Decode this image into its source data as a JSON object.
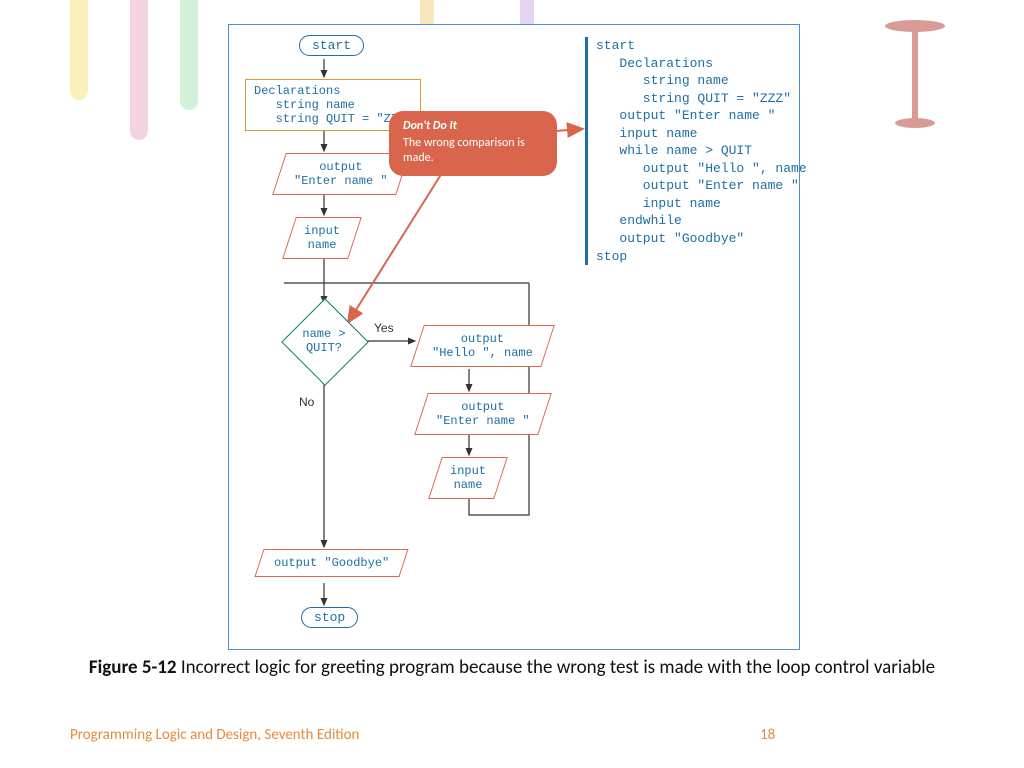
{
  "flowchart": {
    "start": "start",
    "stop": "stop",
    "declarations": "Declarations\n   string name\n   string QUIT = \"ZZZ\"",
    "out_enter1": "output\n\"Enter name \"",
    "in_name1": "input\nname",
    "decision": "name >\nQUIT?",
    "yes": "Yes",
    "no": "No",
    "out_hello": "output\n\"Hello \", name",
    "out_enter2": "output\n\"Enter name \"",
    "in_name2": "input\nname",
    "out_goodbye": "output \"Goodbye\""
  },
  "callout": {
    "title": "Don't Do It",
    "body": "The wrong comparison is made."
  },
  "pseudocode": "start\n   Declarations\n      string name\n      string QUIT = \"ZZZ\"\n   output \"Enter name \"\n   input name\n   while name > QUIT\n      output \"Hello \", name\n      output \"Enter name \"\n      input name\n   endwhile\n   output \"Goodbye\"\nstop",
  "caption_bold": "Figure 5-12",
  "caption_rest": " Incorrect logic for greeting program because the wrong test is made with the loop control variable",
  "footer_book": "Programming Logic and Design, Seventh Edition",
  "footer_page": "18"
}
